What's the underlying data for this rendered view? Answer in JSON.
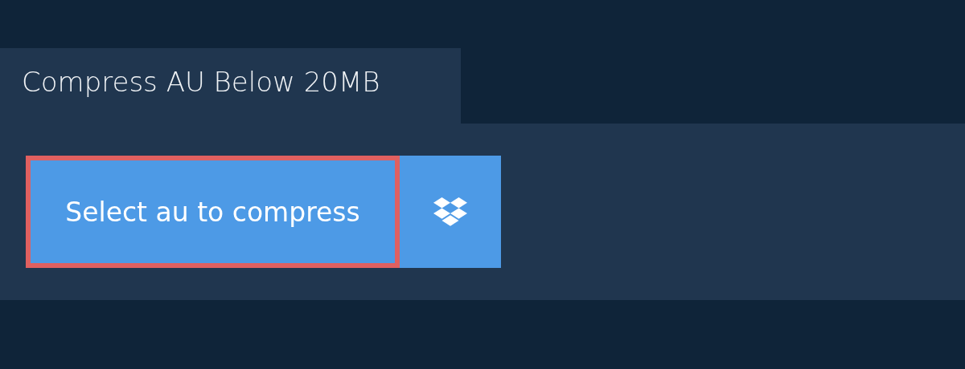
{
  "tab": {
    "label": "Compress AU Below 20MB"
  },
  "select_button": {
    "label": "Select au to compress",
    "focused": true
  }
}
